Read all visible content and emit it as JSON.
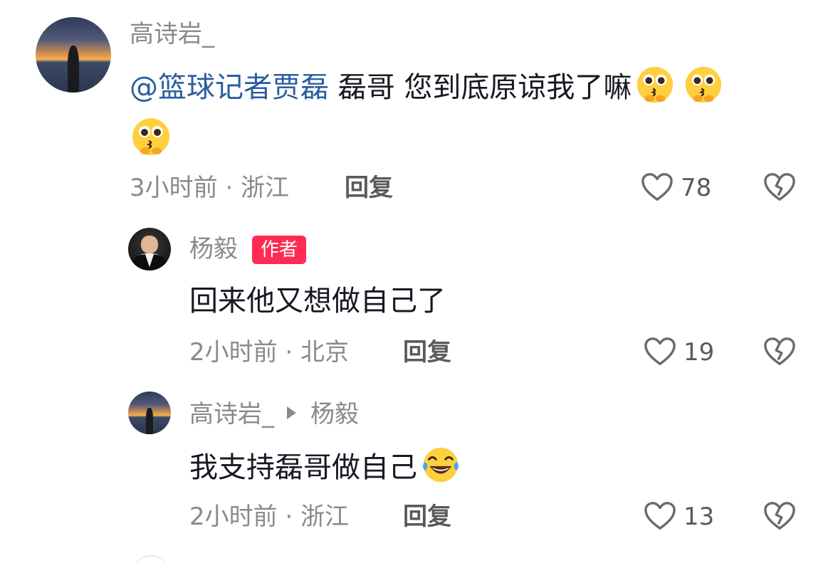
{
  "comments": [
    {
      "username": "高诗岩_",
      "mention": "@篮球记者贾磊",
      "text": " 磊哥 您到底原谅我了嘛",
      "emoji_names": [
        "pleading-kiss-emoji",
        "pleading-kiss-emoji",
        "pleading-kiss-emoji"
      ],
      "meta": "3小时前 · 浙江",
      "reply_label": "回复",
      "likes": "78"
    },
    {
      "username": "杨毅",
      "badge": "作者",
      "text": "回来他又想做自己了",
      "meta": "2小时前 · 北京",
      "reply_label": "回复",
      "likes": "19"
    },
    {
      "username": "高诗岩_",
      "reply_to": "杨毅",
      "text": "我支持磊哥做自己",
      "emoji_names": [
        "laughing-tears-emoji"
      ],
      "meta": "2小时前 · 浙江",
      "reply_label": "回复",
      "likes": "13"
    }
  ],
  "colors": {
    "mention": "#2b5d9e",
    "author_badge": "#fe2c55",
    "meta_gray": "#8a8a8a",
    "text": "#161823"
  }
}
